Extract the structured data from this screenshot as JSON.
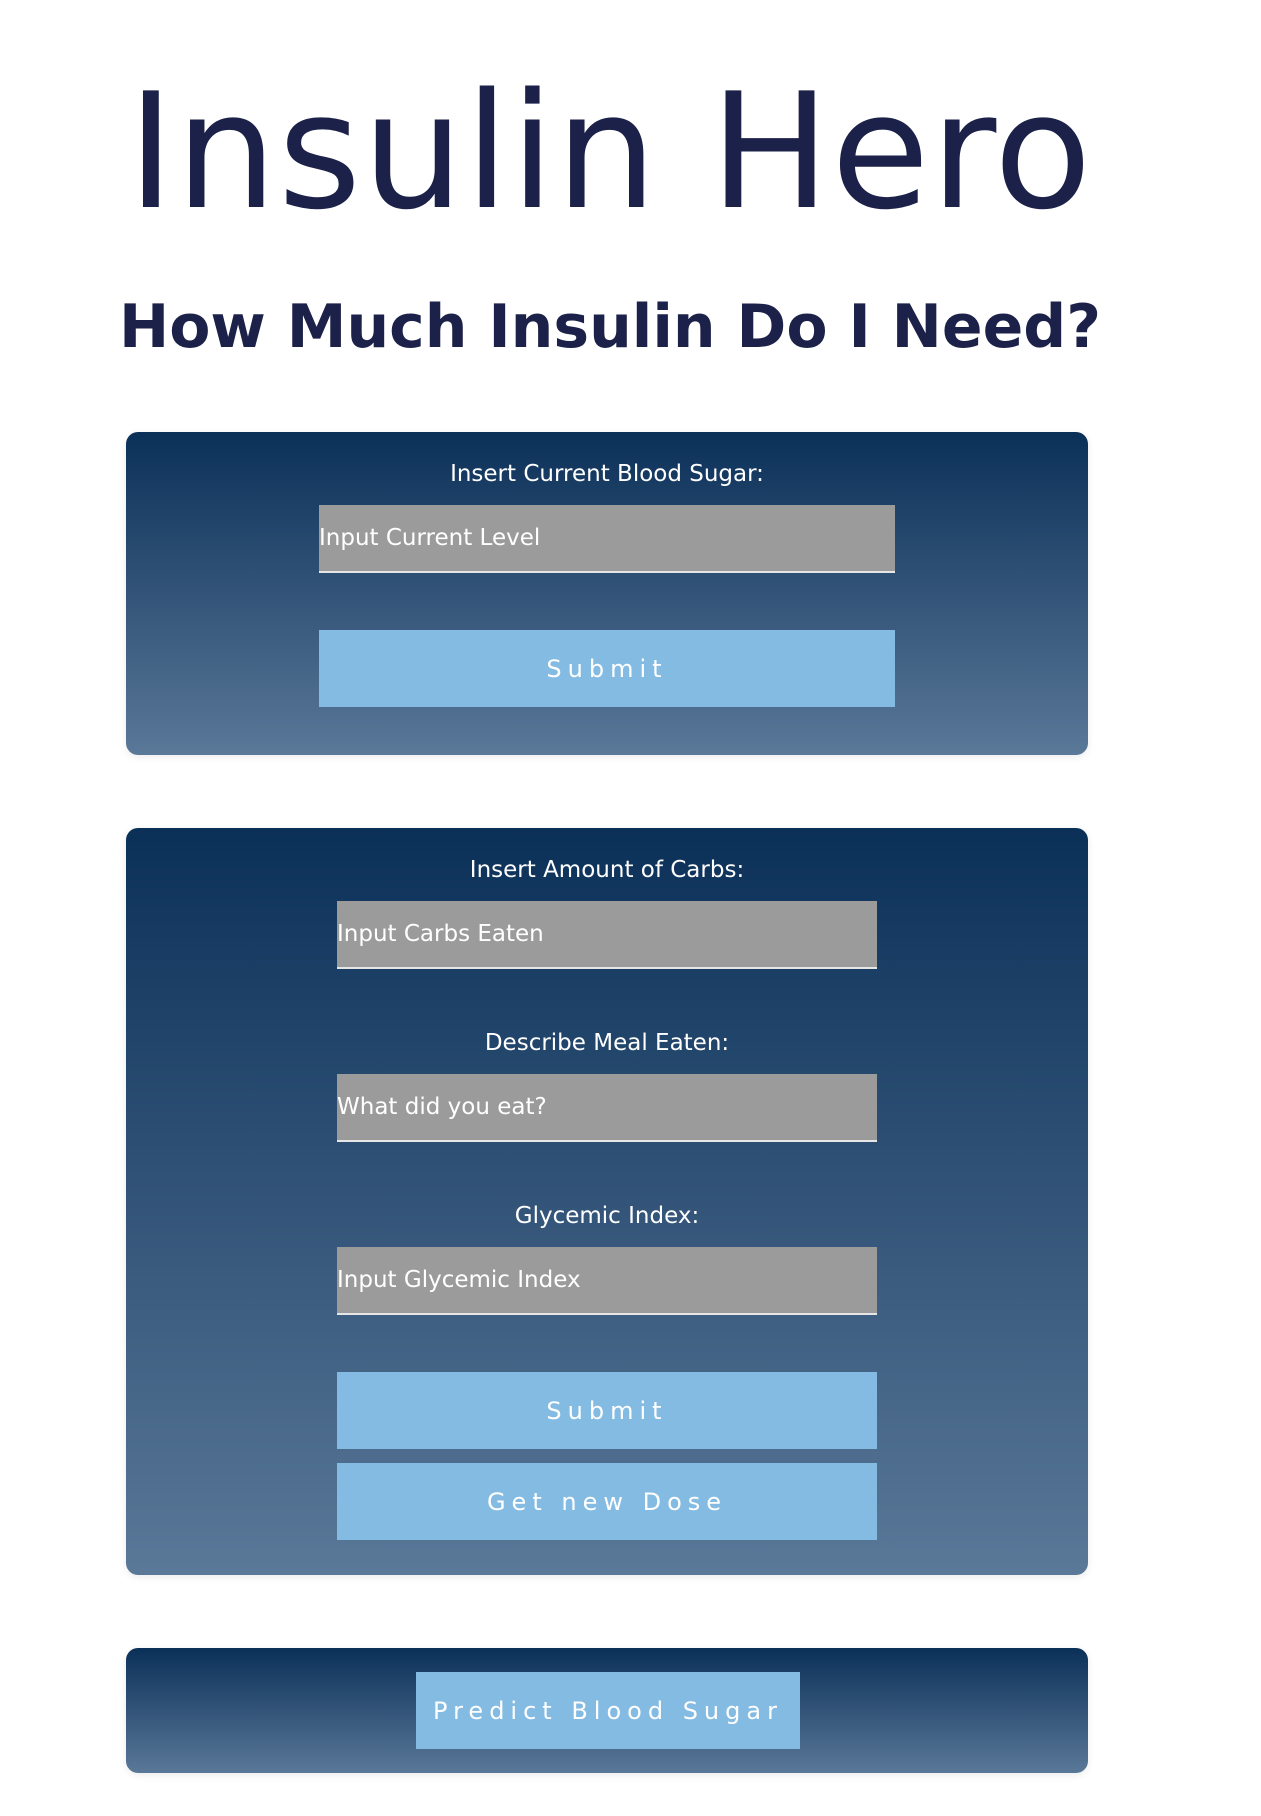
{
  "header": {
    "title": "Insulin Hero",
    "subtitle": "How Much Insulin Do I Need?"
  },
  "blood_sugar_card": {
    "label": "Insert Current Blood Sugar:",
    "input_placeholder": "Input Current Level",
    "submit_label": "Submit"
  },
  "meal_card": {
    "carbs_label": "Insert Amount of Carbs:",
    "carbs_placeholder": "Input Carbs Eaten",
    "meal_label": "Describe Meal Eaten:",
    "meal_placeholder": "What did you eat?",
    "glycemic_label": "Glycemic Index:",
    "glycemic_placeholder": "Input Glycemic Index",
    "submit_label": "Submit",
    "new_dose_label": "Get new Dose"
  },
  "predict_card": {
    "predict_label": "Predict Blood Sugar"
  },
  "colors": {
    "title_color": "#1b2148",
    "card_gradient_top": "#0b3058",
    "card_gradient_bottom": "#5a7898",
    "input_background": "#9b9b9b",
    "button_background": "#84bbe2"
  }
}
